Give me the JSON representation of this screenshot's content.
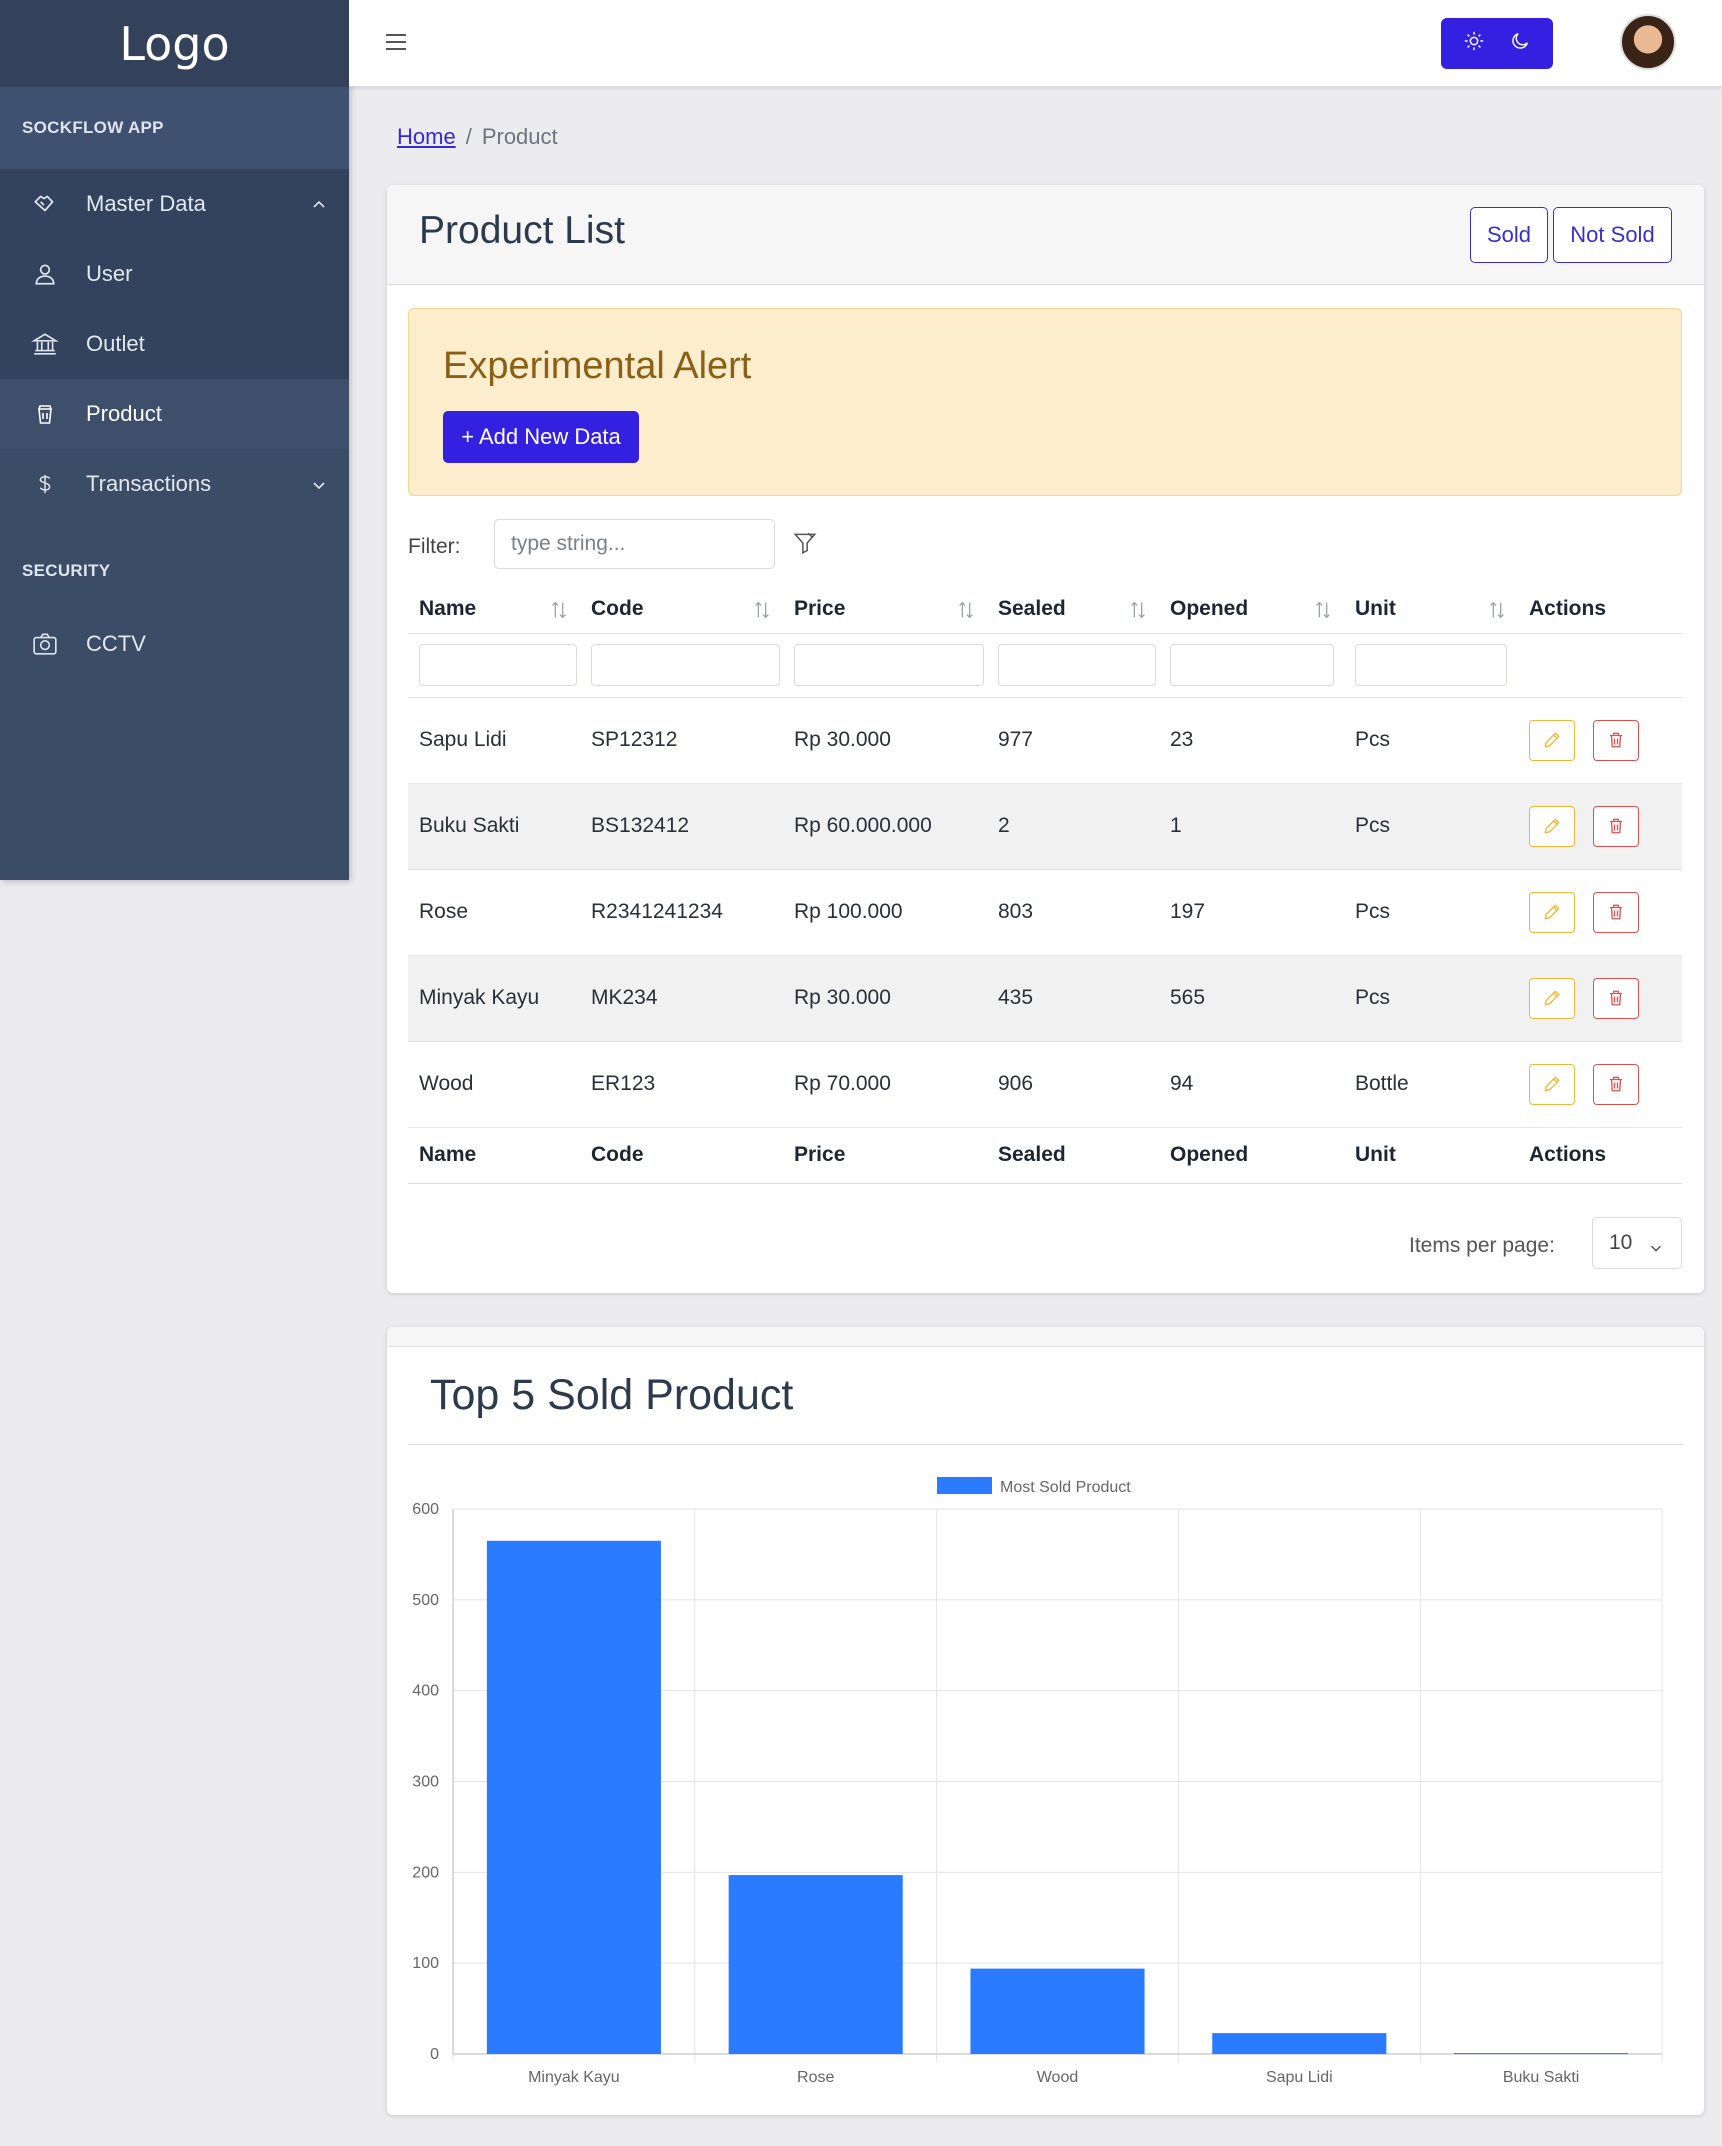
{
  "sidebar": {
    "logo": "Logo",
    "app_section": "SOCKFLOW APP",
    "items": [
      {
        "label": "Master Data",
        "icon": "handshake-icon"
      },
      {
        "label": "User",
        "icon": "user-icon"
      },
      {
        "label": "Outlet",
        "icon": "bank-icon"
      },
      {
        "label": "Product",
        "icon": "cup-icon"
      },
      {
        "label": "Transactions",
        "icon": "dollar-icon"
      }
    ],
    "security_section": "SECURITY",
    "security_items": [
      {
        "label": "CCTV",
        "icon": "camera-icon"
      }
    ]
  },
  "header": {
    "menu_icon": "hamburger-icon",
    "theme_icons": [
      "sun-icon",
      "moon-icon"
    ],
    "avatar": "avatar"
  },
  "breadcrumb": {
    "home": "Home",
    "separator": "/",
    "current": "Product"
  },
  "product_card": {
    "title": "Product List",
    "sold_label": "Sold",
    "not_sold_label": "Not Sold",
    "alert_title": "Experimental Alert",
    "add_label": "+ Add New Data",
    "filter_label": "Filter:",
    "filter_placeholder": "type string...",
    "columns": [
      "Name",
      "Code",
      "Price",
      "Sealed",
      "Opened",
      "Unit",
      "Actions"
    ],
    "rows": [
      {
        "name": "Sapu Lidi",
        "code": "SP12312",
        "price": "Rp 30.000",
        "sealed": "977",
        "opened": "23",
        "unit": "Pcs"
      },
      {
        "name": "Buku Sakti",
        "code": "BS132412",
        "price": "Rp 60.000.000",
        "sealed": "2",
        "opened": "1",
        "unit": "Pcs"
      },
      {
        "name": "Rose",
        "code": "R2341241234",
        "price": "Rp 100.000",
        "sealed": "803",
        "opened": "197",
        "unit": "Pcs"
      },
      {
        "name": "Minyak Kayu",
        "code": "MK234",
        "price": "Rp 30.000",
        "sealed": "435",
        "opened": "565",
        "unit": "Pcs"
      },
      {
        "name": "Wood",
        "code": "ER123",
        "price": "Rp 70.000",
        "sealed": "906",
        "opened": "94",
        "unit": "Bottle"
      }
    ],
    "items_per_page_label": "Items per page:",
    "items_per_page_value": "10"
  },
  "chart_card": {
    "title": "Top 5 Sold Product"
  },
  "colors": {
    "primary": "#3420e0",
    "sidebar": "#3b4c67",
    "bar": "#2a7bff",
    "alert_bg": "#fcedcd",
    "alert_text": "#8a5f16"
  },
  "chart_data": {
    "type": "bar",
    "categories": [
      "Minyak Kayu",
      "Rose",
      "Wood",
      "Sapu Lidi",
      "Buku Sakti"
    ],
    "series": [
      {
        "name": "Most Sold Product",
        "values": [
          565,
          197,
          94,
          23,
          1
        ]
      }
    ],
    "ylim": [
      0,
      600
    ],
    "yticks": [
      0,
      100,
      200,
      300,
      400,
      500,
      600
    ],
    "legend": "top",
    "grid": true
  }
}
